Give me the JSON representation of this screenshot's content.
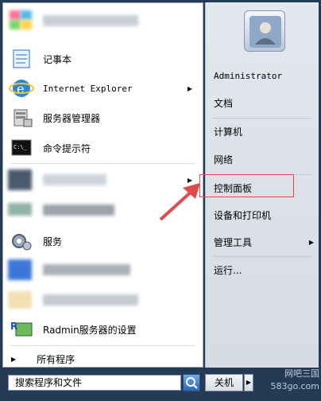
{
  "left_menu": {
    "notepad": "记事本",
    "ie": "Internet Explorer",
    "server_manager": "服务器管理器",
    "cmd": "命令提示符",
    "services": "服务",
    "radmin": "Radmin服务器的设置",
    "all_programs": "所有程序"
  },
  "right_menu": {
    "user": "Administrator",
    "documents": "文档",
    "computer": "计算机",
    "network": "网络",
    "control_panel": "控制面板",
    "devices_printers": "设备和打印机",
    "admin_tools": "管理工具",
    "run": "运行..."
  },
  "bottom": {
    "search_placeholder": "搜索程序和文件",
    "shutdown": "关机"
  },
  "watermark": "网吧三国 583go.com",
  "colors": {
    "highlight_box": "#e04b4b",
    "arrow": "#e04b4b"
  }
}
